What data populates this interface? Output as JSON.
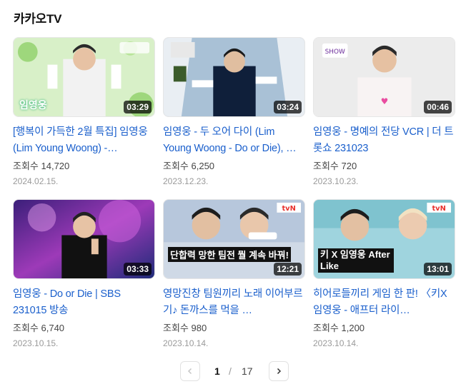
{
  "section": {
    "title": "카카오TV"
  },
  "videos": [
    {
      "title": "[행복이 가득한 2월 특집] 임영웅 (Lim Young Woong) -…",
      "views": "조회수 14,720",
      "date": "2024.02.15.",
      "duration": "03:29",
      "overlay": "임영웅"
    },
    {
      "title": "임영웅 - 두 오어 다이 (Lim Young Woong - Do or Die), …",
      "views": "조회수 6,250",
      "date": "2023.12.23.",
      "duration": "03:24",
      "overlay": ""
    },
    {
      "title": "임영웅 - 명예의 전당 VCR | 더 트롯쇼 231023",
      "views": "조회수 720",
      "date": "2023.10.23.",
      "duration": "00:46",
      "overlay": ""
    },
    {
      "title": "임영웅 - Do or Die | SBS 231015 방송",
      "views": "조회수 6,740",
      "date": "2023.10.15.",
      "duration": "03:33",
      "overlay": ""
    },
    {
      "title": "영망진창 팀원끼리 노래 이어부르기♪ 돈까스를 먹을 …",
      "views": "조회수 980",
      "date": "2023.10.14.",
      "duration": "12:21",
      "overlay": "단합력 망한 팀전 뭘 계속 바꿔!"
    },
    {
      "title": "히어로들끼리 게임 한 판! 〈키X임영웅 - 애프터 라이…",
      "views": "조회수 1,200",
      "date": "2023.10.14.",
      "duration": "13:01",
      "overlay": "키 X 임영웅 After Like"
    }
  ],
  "pagination": {
    "current": "1",
    "separator": "/",
    "total": "17"
  },
  "colors": {
    "link": "#1a5fcc",
    "accent_orange": "#ff8a00"
  }
}
